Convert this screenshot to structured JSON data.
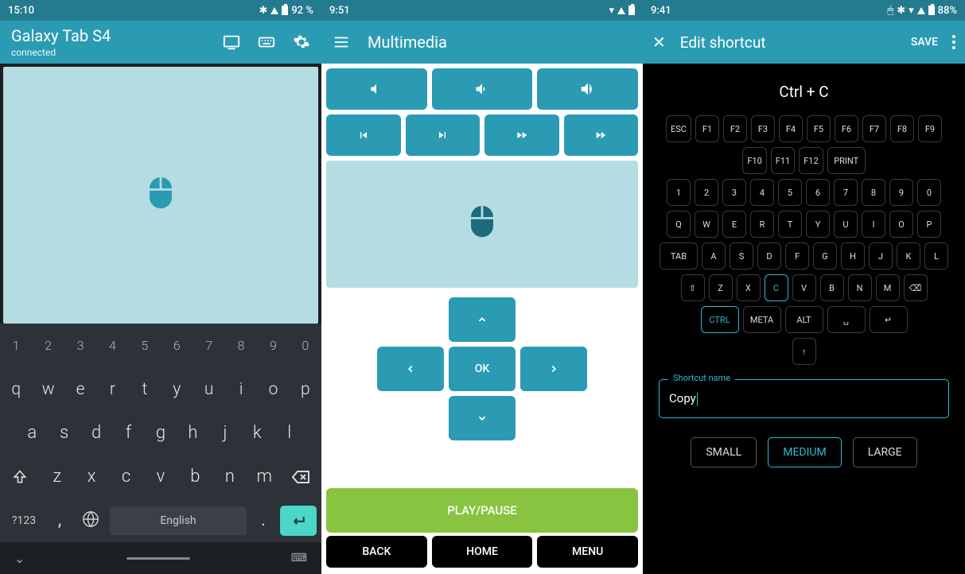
{
  "screen1": {
    "status": {
      "time": "15:10",
      "battery": "92 %"
    },
    "title": "Galaxy Tab S4",
    "subtitle": "connected",
    "kb": {
      "nums": [
        "1",
        "2",
        "3",
        "4",
        "5",
        "6",
        "7",
        "8",
        "9",
        "0"
      ],
      "row1": [
        "q",
        "w",
        "e",
        "r",
        "t",
        "y",
        "u",
        "i",
        "o",
        "p"
      ],
      "row2": [
        "a",
        "s",
        "d",
        "f",
        "g",
        "h",
        "j",
        "k",
        "l"
      ],
      "row3": [
        "z",
        "x",
        "c",
        "v",
        "b",
        "n",
        "m"
      ],
      "sym": "?123",
      "lang": "English"
    }
  },
  "screen2": {
    "status": {
      "time": "9:51"
    },
    "title": "Multimedia",
    "ok": "OK",
    "play": "PLAY/PAUSE",
    "nav": {
      "back": "BACK",
      "home": "HOME",
      "menu": "MENU"
    }
  },
  "screen3": {
    "status": {
      "time": "9:41",
      "battery": "88%"
    },
    "title": "Edit shortcut",
    "save": "SAVE",
    "combo": "Ctrl + C",
    "rowF1": [
      "ESC",
      "F1",
      "F2",
      "F3",
      "F4",
      "F5",
      "F6",
      "F7",
      "F8",
      "F9"
    ],
    "rowF2": [
      "F10",
      "F11",
      "F12",
      "PRINT"
    ],
    "rowNum": [
      "1",
      "2",
      "3",
      "4",
      "5",
      "6",
      "7",
      "8",
      "9",
      "0"
    ],
    "rowQ": [
      "Q",
      "W",
      "E",
      "R",
      "T",
      "Y",
      "U",
      "I",
      "O",
      "P"
    ],
    "rowA": [
      "TAB",
      "A",
      "S",
      "D",
      "F",
      "G",
      "H",
      "J",
      "K",
      "L"
    ],
    "rowZ": [
      "⇧",
      "Z",
      "X",
      "C",
      "V",
      "B",
      "N",
      "M",
      "⌫"
    ],
    "rowMod": [
      "CTRL",
      "META",
      "ALT",
      "␣",
      "↵"
    ],
    "arrow_up": "↑",
    "input_label": "Shortcut name",
    "input_value": "Copy",
    "sizes": [
      "SMALL",
      "MEDIUM",
      "LARGE"
    ],
    "size_selected": "MEDIUM"
  }
}
